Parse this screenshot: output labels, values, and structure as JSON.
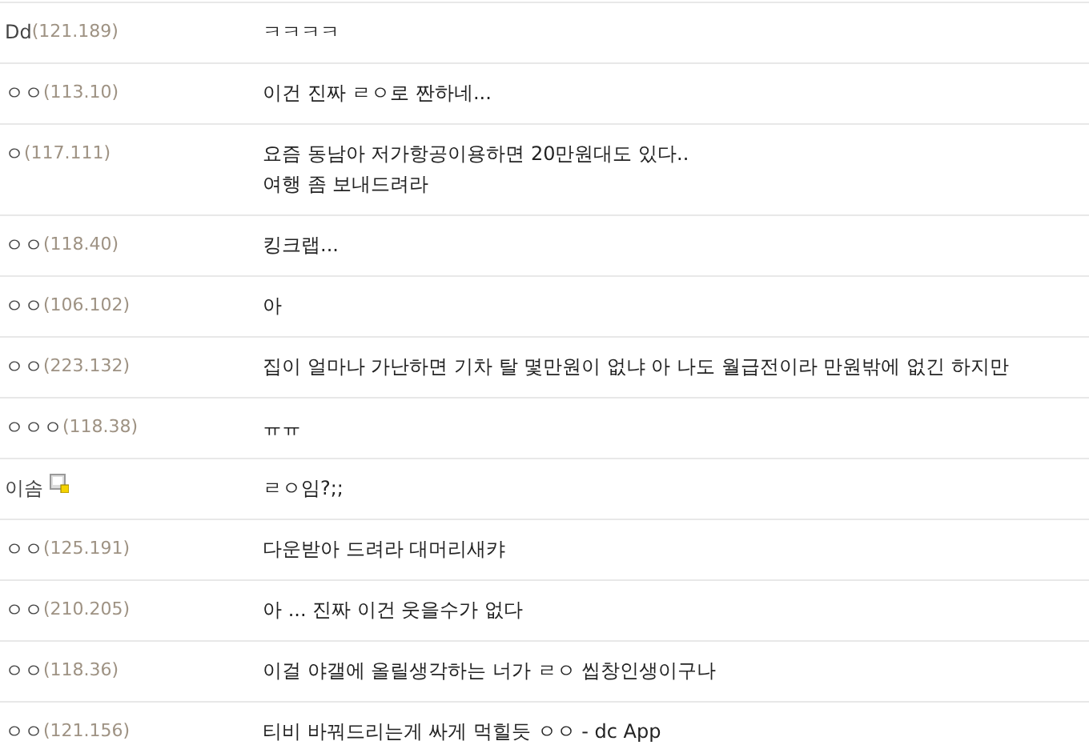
{
  "comments": [
    {
      "kind": "guest",
      "nickname": "Dd",
      "ip": "(121.189)",
      "text": "ㅋㅋㅋㅋ"
    },
    {
      "kind": "guest",
      "nickname": "ㅇㅇ",
      "ip": "(113.10)",
      "text": "이건 진짜 ㄹㅇ로 짠하네..."
    },
    {
      "kind": "guest",
      "nickname": "ㅇ",
      "ip": "(117.111)",
      "text": "요즘 동남아 저가항공이용하면 20만원대도 있다..\n여행 좀 보내드려라"
    },
    {
      "kind": "guest",
      "nickname": "ㅇㅇ",
      "ip": "(118.40)",
      "text": "킹크랩..."
    },
    {
      "kind": "guest",
      "nickname": "ㅇㅇ",
      "ip": "(106.102)",
      "text": "아"
    },
    {
      "kind": "guest",
      "nickname": "ㅇㅇ",
      "ip": "(223.132)",
      "text": "집이 얼마나 가난하면 기차 탈 몇만원이 없냐 아 나도 월급전이라 만원밖에 없긴 하지만"
    },
    {
      "kind": "guest",
      "nickname": "ㅇㅇㅇ",
      "ip": "(118.38)",
      "text": "ㅠㅠ"
    },
    {
      "kind": "member",
      "nickname": "이솜",
      "text": "ㄹㅇ임?;;"
    },
    {
      "kind": "guest",
      "nickname": "ㅇㅇ",
      "ip": "(125.191)",
      "text": "다운받아 드려라 대머리새캬"
    },
    {
      "kind": "guest",
      "nickname": "ㅇㅇ",
      "ip": "(210.205)",
      "text": "아 ... 진짜 이건 웃을수가 없다"
    },
    {
      "kind": "guest",
      "nickname": "ㅇㅇ",
      "ip": "(118.36)",
      "text": "이걸 야갤에 올릴생각하는 너가 ㄹㅇ 씹창인생이구나"
    },
    {
      "kind": "guest",
      "nickname": "ㅇㅇ",
      "ip": "(121.156)",
      "text": "티비 바꿔드리는게 싸게 먹힐듯 ㅇㅇ - dc App"
    }
  ]
}
